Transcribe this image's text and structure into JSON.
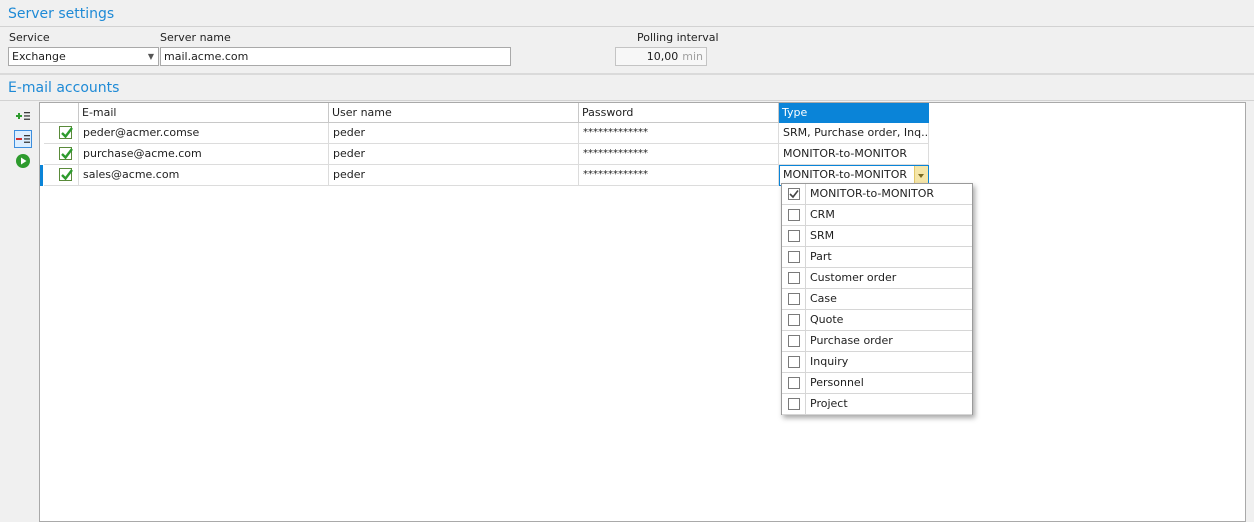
{
  "server_settings": {
    "title": "Server settings",
    "service": {
      "label": "Service",
      "value": "Exchange"
    },
    "server_name": {
      "label": "Server name",
      "value": "mail.acme.com"
    },
    "polling_interval": {
      "label": "Polling interval",
      "value": "10,00",
      "unit": "min"
    }
  },
  "email_accounts": {
    "title": "E-mail accounts",
    "toolbar": {
      "add_icon": "add-row-icon",
      "remove_icon": "remove-row-icon",
      "run_icon": "play-icon"
    },
    "columns": [
      "E-mail",
      "User name",
      "Password",
      "Type"
    ],
    "rows": [
      {
        "email": "peder@acmer.comse",
        "user": "peder",
        "password": "*************",
        "type": "SRM, Purchase order, Inq..."
      },
      {
        "email": "purchase@acme.com",
        "user": "peder",
        "password": "*************",
        "type": "MONITOR-to-MONITOR"
      },
      {
        "email": "sales@acme.com",
        "user": "peder",
        "password": "*************",
        "type": "MONITOR-to-MONITOR"
      }
    ],
    "type_options": [
      {
        "label": "MONITOR-to-MONITOR",
        "checked": true
      },
      {
        "label": "CRM",
        "checked": false
      },
      {
        "label": "SRM",
        "checked": false
      },
      {
        "label": "Part",
        "checked": false
      },
      {
        "label": "Customer order",
        "checked": false
      },
      {
        "label": "Case",
        "checked": false
      },
      {
        "label": "Quote",
        "checked": false
      },
      {
        "label": "Purchase order",
        "checked": false
      },
      {
        "label": "Inquiry",
        "checked": false
      },
      {
        "label": "Personnel",
        "checked": false
      },
      {
        "label": "Project",
        "checked": false
      }
    ]
  },
  "colors": {
    "accent": "#0a84d8",
    "title": "#1e8ad6",
    "check": "#2e9b2e"
  }
}
